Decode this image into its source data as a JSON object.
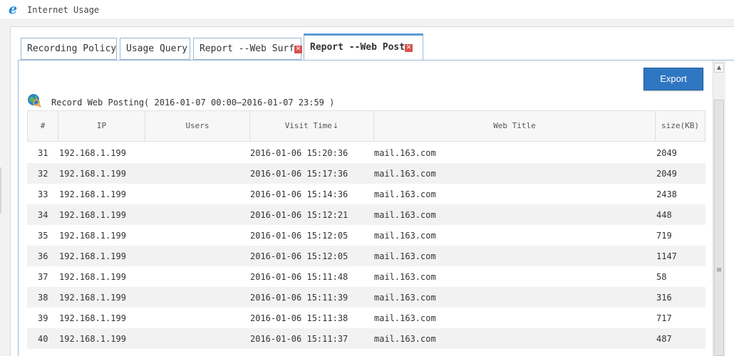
{
  "app": {
    "title": "Internet Usage",
    "icon": "ie-icon"
  },
  "tabs": [
    {
      "label": "Recording Policy",
      "closable": false
    },
    {
      "label": "Usage Query",
      "closable": false
    },
    {
      "label": "Report --Web Surf",
      "closable": true
    },
    {
      "label": "Report --Web Post",
      "closable": true,
      "active": true
    }
  ],
  "toolbar": {
    "export_label": "Export"
  },
  "record": {
    "title": "Record Web Posting( 2016-01-07 00:00—2016-01-07 23:59 )"
  },
  "table": {
    "columns": [
      "#",
      "IP",
      "Users",
      "Visit Time",
      "Web Title",
      "size(KB)"
    ],
    "sort_column": "Visit Time",
    "sort_direction": "desc",
    "rows": [
      {
        "num": "31",
        "ip": "192.168.1.199",
        "user": "",
        "time": "2016-01-06 15:20:36",
        "title": "mail.163.com",
        "size": "2049"
      },
      {
        "num": "32",
        "ip": "192.168.1.199",
        "user": "",
        "time": "2016-01-06 15:17:36",
        "title": "mail.163.com",
        "size": "2049"
      },
      {
        "num": "33",
        "ip": "192.168.1.199",
        "user": "",
        "time": "2016-01-06 15:14:36",
        "title": "mail.163.com",
        "size": "2438"
      },
      {
        "num": "34",
        "ip": "192.168.1.199",
        "user": "",
        "time": "2016-01-06 15:12:21",
        "title": "mail.163.com",
        "size": "448"
      },
      {
        "num": "35",
        "ip": "192.168.1.199",
        "user": "",
        "time": "2016-01-06 15:12:05",
        "title": "mail.163.com",
        "size": "719"
      },
      {
        "num": "36",
        "ip": "192.168.1.199",
        "user": "",
        "time": "2016-01-06 15:12:05",
        "title": "mail.163.com",
        "size": "1147"
      },
      {
        "num": "37",
        "ip": "192.168.1.199",
        "user": "",
        "time": "2016-01-06 15:11:48",
        "title": "mail.163.com",
        "size": "58"
      },
      {
        "num": "38",
        "ip": "192.168.1.199",
        "user": "",
        "time": "2016-01-06 15:11:39",
        "title": "mail.163.com",
        "size": "316"
      },
      {
        "num": "39",
        "ip": "192.168.1.199",
        "user": "",
        "time": "2016-01-06 15:11:38",
        "title": "mail.163.com",
        "size": "717"
      },
      {
        "num": "40",
        "ip": "192.168.1.199",
        "user": "",
        "time": "2016-01-06 15:11:37",
        "title": "mail.163.com",
        "size": "487"
      }
    ]
  },
  "colors": {
    "accent": "#2f76c2",
    "tab_border": "#9bb7d4",
    "close_red": "#d9534f",
    "row_alt": "#f2f2f2"
  }
}
